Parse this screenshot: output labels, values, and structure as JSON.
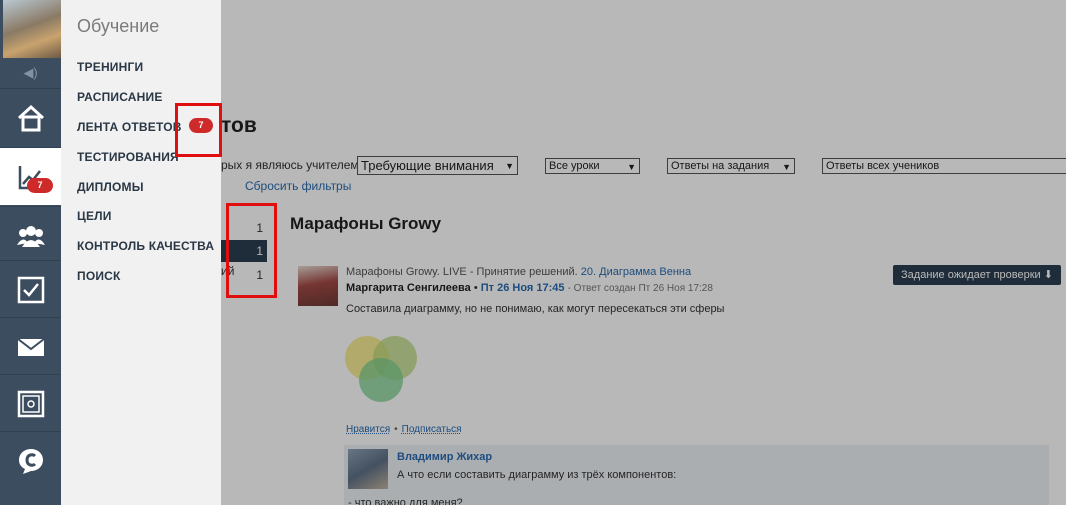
{
  "rail": {
    "badge": "7",
    "items": [
      "home-icon",
      "chart-icon",
      "users-icon",
      "checkbox-icon",
      "mail-icon",
      "safe-icon",
      "chat-icon"
    ]
  },
  "menu": {
    "title": "Обучение",
    "items": [
      "ТРЕНИНГИ",
      "РАСПИСАНИЕ",
      "ЛЕНТА ОТВЕТОВ",
      "ТЕСТИРОВАНИЯ",
      "ДИПЛОМЫ",
      "ЦЕЛИ",
      "КОНТРОЛЬ КАЧЕСТВА",
      "ПОИСК"
    ],
    "feed_badge": "7"
  },
  "main": {
    "heading": "тов",
    "filter_label": "рых я являюсь учителем",
    "filters": {
      "needs_attention": "Требующие внимания",
      "lessons": "Все уроки",
      "answers": "Ответы на задания",
      "students": "Ответы всех учеников"
    },
    "reset_filters": "Сбросить фильтры",
    "counts": [
      "1",
      "1",
      "1"
    ],
    "ghost_text": "ий",
    "section_title": "Марафоны Growy",
    "post": {
      "course": "Марафоны Growy. LIVE - Принятие решений.",
      "lesson": "20. Диаграмма Венна",
      "author": "Маргарита Сенгилеева",
      "date": "Пт 26 Ноя 17:45",
      "created": "- Ответ создан Пт 26 Ноя 17:28",
      "status": "Задание ожидает проверки ⬇",
      "text": "Составила диаграмму, но не понимаю, как могут пересекаться эти сферы",
      "like": "Нравится",
      "separator": "•",
      "subscribe": "Подписаться"
    },
    "reply": {
      "author": "Владимир Жихар",
      "text": "А что если составить диаграмму из трёх компонентов:",
      "text2": "- что важно для меня?"
    }
  }
}
